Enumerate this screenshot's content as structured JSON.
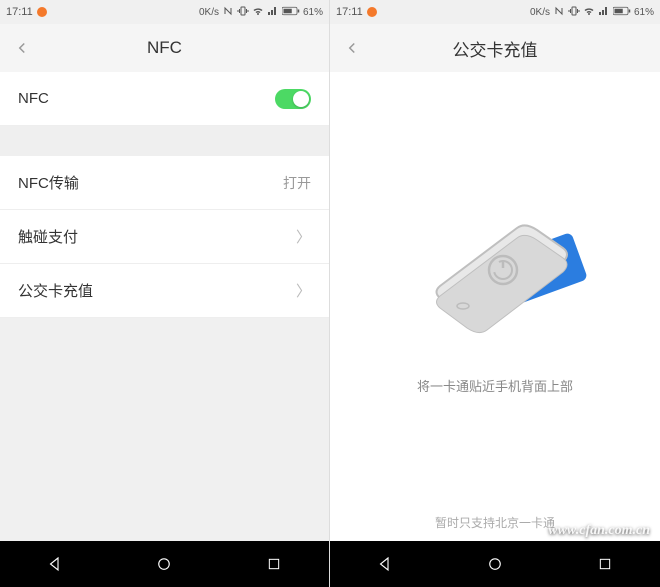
{
  "status": {
    "time": "17:11",
    "net_speed": "0K/s",
    "battery_pct": "61%"
  },
  "left": {
    "title": "NFC",
    "rows": {
      "nfc_toggle_label": "NFC",
      "nfc_transfer_label": "NFC传输",
      "nfc_transfer_value": "打开",
      "tap_pay_label": "触碰支付",
      "transit_recharge_label": "公交卡充值"
    }
  },
  "right": {
    "title": "公交卡充值",
    "instruction": "将一卡通贴近手机背面上部",
    "support_note": "暂时只支持北京一卡通"
  },
  "watermark": "www.cfan.com.cn"
}
